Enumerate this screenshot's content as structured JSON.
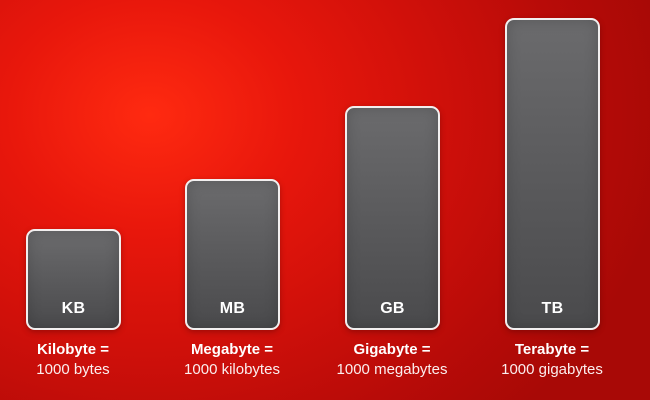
{
  "units": [
    {
      "abbr": "KB",
      "name": "Kilobyte =",
      "equivalent": "1000 bytes"
    },
    {
      "abbr": "MB",
      "name": "Megabyte =",
      "equivalent": "1000 kilobytes"
    },
    {
      "abbr": "GB",
      "name": "Gigabyte =",
      "equivalent": "1000 megabytes"
    },
    {
      "abbr": "TB",
      "name": "Terabyte =",
      "equivalent": "1000 gigabytes"
    }
  ],
  "colors": {
    "background": "#d0100a",
    "bar_fill": "#5c5c5e",
    "bar_border": "#f2efef",
    "text": "#ffffff"
  }
}
